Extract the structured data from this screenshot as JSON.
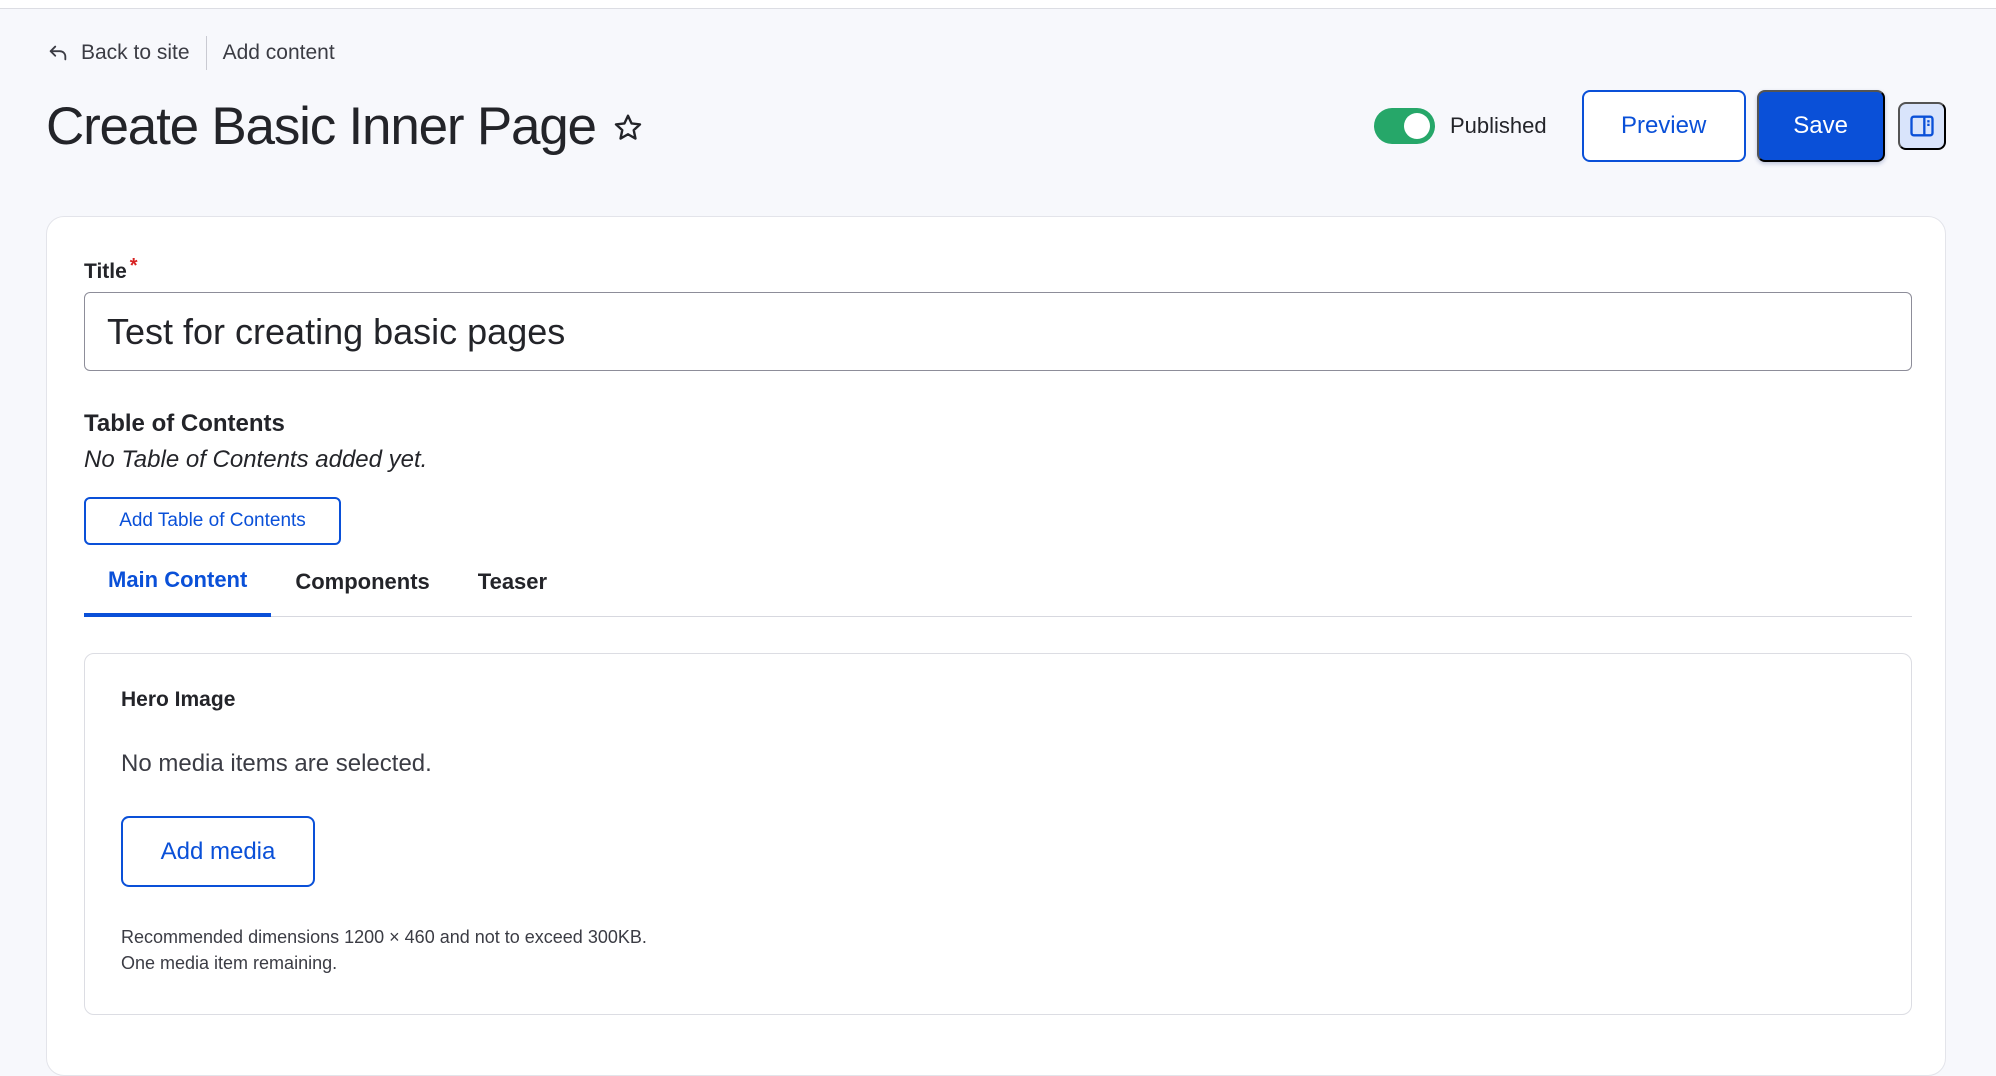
{
  "breadcrumb": {
    "back_label": "Back to site",
    "current_label": "Add content"
  },
  "header": {
    "title": "Create Basic Inner Page",
    "published_label": "Published",
    "published": true,
    "preview_label": "Preview",
    "save_label": "Save"
  },
  "form": {
    "title_label": "Title",
    "title_required_marker": "*",
    "title_value": "Test for creating basic pages",
    "toc": {
      "heading": "Table of Contents",
      "empty_text": "No Table of Contents added yet.",
      "add_button_label": "Add Table of Contents"
    },
    "tabs": [
      {
        "label": "Main Content",
        "active": true
      },
      {
        "label": "Components",
        "active": false
      },
      {
        "label": "Teaser",
        "active": false
      }
    ],
    "hero": {
      "label": "Hero Image",
      "empty_text": "No media items are selected.",
      "add_button_label": "Add media",
      "help_line1": "Recommended dimensions 1200 × 460 and not to exceed 300KB.",
      "help_line2": "One media item remaining."
    }
  },
  "colors": {
    "accent": "#0a50d8",
    "toggle_on": "#26a769",
    "required": "#d72222",
    "background": "#f7f8fc"
  },
  "icons": {
    "back": "back-arrow-icon",
    "favorite": "star-icon",
    "sidebar": "sidebar-panel-icon"
  }
}
